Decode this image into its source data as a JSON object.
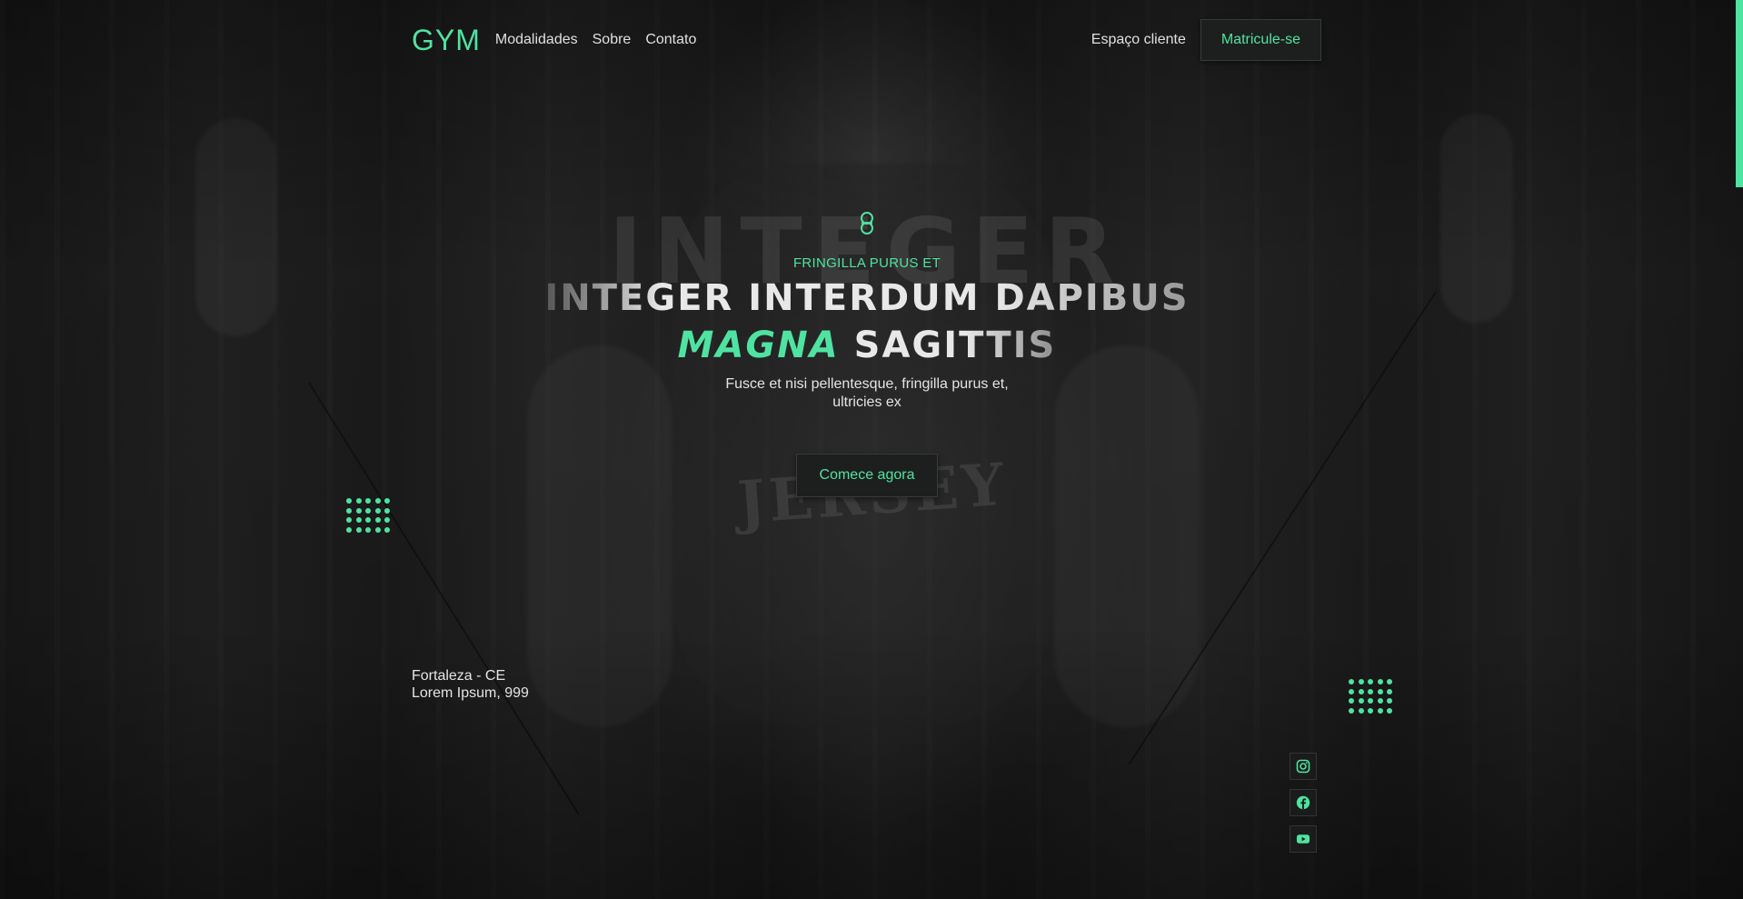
{
  "brand": {
    "logo": "GYM",
    "accent_color": "#4fe3a1"
  },
  "nav": {
    "items": [
      {
        "label": "Modalidades"
      },
      {
        "label": "Sobre"
      },
      {
        "label": "Contato"
      }
    ],
    "client_link": "Espaço cliente",
    "signup_button": "Matricule-se"
  },
  "hero": {
    "icon": "dumbbell-icon",
    "background_word": "INTEGER",
    "eyebrow": "FRINGILLA PURUS ET",
    "headline_line1": "INTEGER INTERDUM DAPIBUS",
    "headline_accent": "MAGNA",
    "headline_rest": "SAGITTIS",
    "subtitle": "Fusce et nisi pellentesque, fringilla purus et, ultricies ex",
    "cta": "Comece agora",
    "photo_text": "JERSEY"
  },
  "location": {
    "city": "Fortaleza - CE",
    "address": "Lorem Ipsum, 999"
  },
  "social": [
    {
      "icon": "instagram-icon"
    },
    {
      "icon": "facebook-icon"
    },
    {
      "icon": "youtube-icon"
    }
  ]
}
